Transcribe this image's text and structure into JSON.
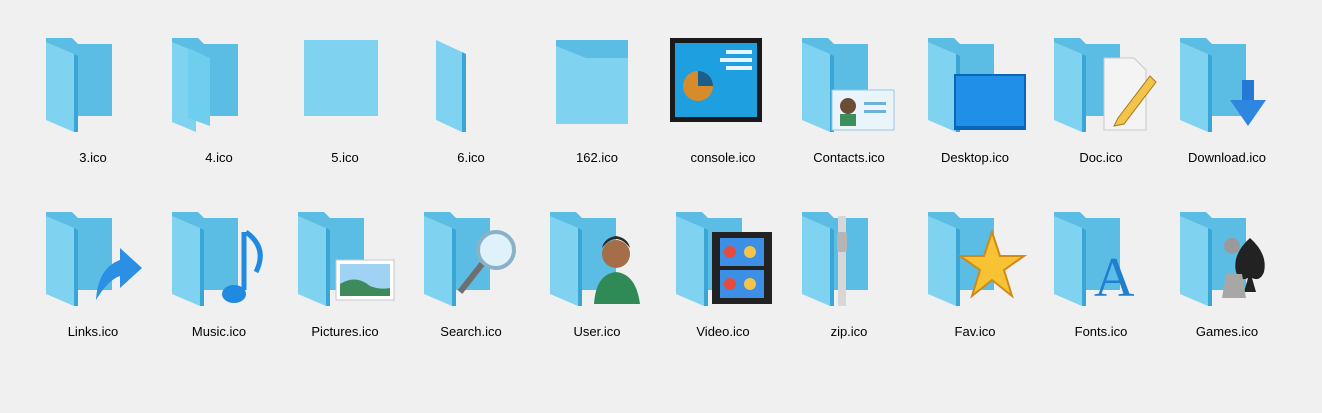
{
  "icons_row1": [
    {
      "name": "3.ico",
      "kind": "folder-open"
    },
    {
      "name": "4.ico",
      "kind": "folder-double"
    },
    {
      "name": "5.ico",
      "kind": "folder-flat"
    },
    {
      "name": "6.ico",
      "kind": "folder-side"
    },
    {
      "name": "162.ico",
      "kind": "folder-front"
    },
    {
      "name": "console.ico",
      "kind": "console"
    },
    {
      "name": "Contacts.ico",
      "kind": "contacts"
    },
    {
      "name": "Desktop.ico",
      "kind": "desktop"
    },
    {
      "name": "Doc.ico",
      "kind": "doc"
    },
    {
      "name": "Download.ico",
      "kind": "download"
    }
  ],
  "icons_row2": [
    {
      "name": "Links.ico",
      "kind": "links"
    },
    {
      "name": "Music.ico",
      "kind": "music"
    },
    {
      "name": "Pictures.ico",
      "kind": "pictures"
    },
    {
      "name": "Search.ico",
      "kind": "search"
    },
    {
      "name": "User.ico",
      "kind": "user"
    },
    {
      "name": "Video.ico",
      "kind": "video"
    },
    {
      "name": "zip.ico",
      "kind": "zip"
    },
    {
      "name": "Fav.ico",
      "kind": "fav"
    },
    {
      "name": "Fonts.ico",
      "kind": "fonts"
    },
    {
      "name": "Games.ico",
      "kind": "games"
    }
  ],
  "colors": {
    "folder_back": "#5bbde4",
    "folder_front": "#7fd3f1",
    "folder_shadow": "#3aa6d6",
    "background": "#f0f0f0"
  }
}
